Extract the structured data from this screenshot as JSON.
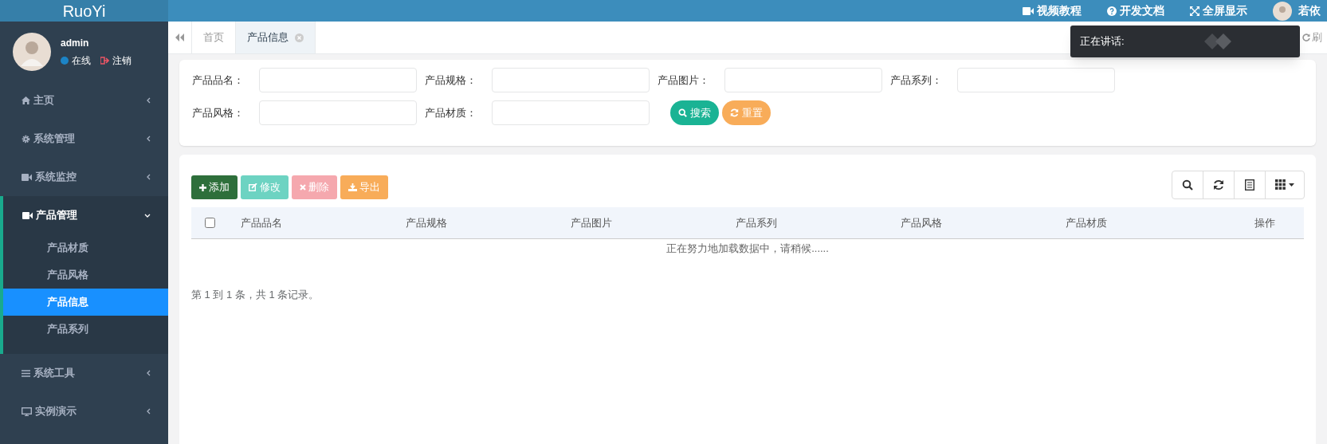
{
  "logo": "RuoYi",
  "header": {
    "links": [
      {
        "kind": "video",
        "label": "视频教程"
      },
      {
        "kind": "help",
        "label": "开发文档"
      },
      {
        "kind": "fullscreen",
        "label": "全屏显示"
      }
    ],
    "user": "若依"
  },
  "user_panel": {
    "name": "admin",
    "status": "在线",
    "logout": "注销"
  },
  "sidebar": {
    "items": [
      {
        "label": "主页",
        "expanded": false
      },
      {
        "label": "系统管理",
        "expanded": false
      },
      {
        "label": "系统监控",
        "expanded": false
      },
      {
        "label": "产品管理",
        "expanded": true,
        "children": [
          {
            "label": "产品材质",
            "selected": false
          },
          {
            "label": "产品风格",
            "selected": false
          },
          {
            "label": "产品信息",
            "selected": true
          },
          {
            "label": "产品系列",
            "selected": false
          }
        ]
      },
      {
        "label": "系统工具",
        "expanded": false
      },
      {
        "label": "实例演示",
        "expanded": false
      }
    ]
  },
  "tabs": [
    {
      "label": "首页",
      "selected": false,
      "closable": false
    },
    {
      "label": "产品信息",
      "selected": true,
      "closable": true
    }
  ],
  "refresh": "刷",
  "toast": {
    "text": "正在讲话:"
  },
  "filters": [
    {
      "label": "产品品名："
    },
    {
      "label": "产品规格："
    },
    {
      "label": "产品图片："
    },
    {
      "label": "产品系列："
    },
    {
      "label": "产品风格："
    },
    {
      "label": "产品材质："
    }
  ],
  "search_buttons": [
    {
      "kind": "search",
      "label": "搜索"
    },
    {
      "kind": "reset",
      "label": "重置"
    }
  ],
  "toolbar": [
    {
      "kind": "add",
      "label": "添加",
      "disabled": false
    },
    {
      "kind": "edit",
      "label": "修改",
      "disabled": true
    },
    {
      "kind": "delete",
      "label": "删除",
      "disabled": true
    },
    {
      "kind": "export",
      "label": "导出",
      "disabled": false
    }
  ],
  "table": {
    "select_all": {
      "checked": false
    },
    "columns": [
      "产品品名",
      "产品规格",
      "产品图片",
      "产品系列",
      "产品风格",
      "产品材质",
      "操作"
    ],
    "loading": "正在努力地加载数据中，请稍候......"
  },
  "pagination": "第 1 到 1 条，共 1 条记录。"
}
